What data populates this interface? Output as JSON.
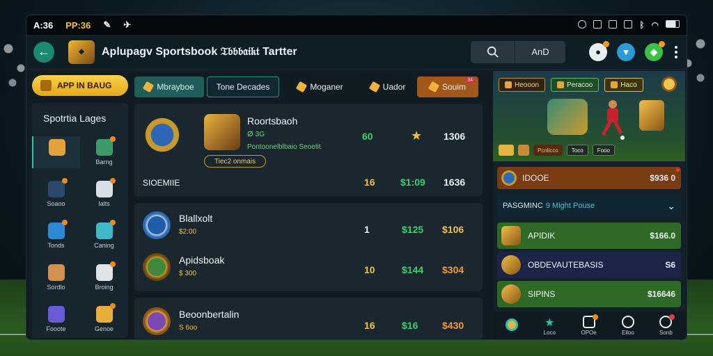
{
  "status": {
    "time": "A:36",
    "account": "PP:36"
  },
  "header": {
    "title": "Aplupagv Sportsbook 𝔗𝔟𝔟𝔟𝔞𝔦𝔨𝔱 Tartter",
    "search_label": "AnD"
  },
  "left": {
    "badge": "APP IN BAUG",
    "sidebar_title": "Spotrtia Lages",
    "items": [
      {
        "label": "",
        "icon": "trophy-icon",
        "color": "#e3a33a"
      },
      {
        "label": "Barng",
        "icon": "shield-icon",
        "color": "#3c9a6b"
      },
      {
        "label": "Soaoo",
        "icon": "grid-icon",
        "color": "#2c4a6c"
      },
      {
        "label": "Ialts",
        "icon": "bracket-icon",
        "color": "#d8dfe5"
      },
      {
        "label": "Tonds",
        "icon": "globe-icon",
        "color": "#2d8bd5"
      },
      {
        "label": "Caning",
        "icon": "tablet-icon",
        "color": "#3fb8c7"
      },
      {
        "label": "Sordlo",
        "icon": "cookie-icon",
        "color": "#d3914f"
      },
      {
        "label": "Broing",
        "icon": "dice-icon",
        "color": "#dfe4e8"
      },
      {
        "label": "Fooote",
        "icon": "cube-icon",
        "color": "#6a5bd6"
      },
      {
        "label": "Genoe",
        "icon": "gift-icon",
        "color": "#e8ad3b"
      }
    ]
  },
  "tabs": [
    {
      "label": "Mbrayboe"
    },
    {
      "label": "Tone Decades"
    },
    {
      "label": "Moganer"
    },
    {
      "label": "Uador"
    },
    {
      "label": "Souim",
      "badge": "34"
    }
  ],
  "featured": {
    "name": "Roortsbaoh",
    "sub1": "ⵁ 3G",
    "sub2": "Pontoonelblbaio Seoetit",
    "pill": "Tiec2 onmais",
    "tag": "SIOEMIIE",
    "odds": "60",
    "score": "1306",
    "bottom": [
      "16",
      "$1:09",
      "1636"
    ]
  },
  "rows": [
    {
      "name": "Blallxolt",
      "sub": "$2:00",
      "a": "1",
      "b": "$125",
      "c": "$106"
    },
    {
      "name": "Apidsboak",
      "sub": "$ 300",
      "a": "10",
      "b": "$144",
      "c": "$304"
    },
    {
      "name": "Beoonbertalin",
      "sub": "S 6oo",
      "a": "16",
      "b": "$16",
      "c": "$430"
    }
  ],
  "right": {
    "hero_tabs": [
      "Heooon",
      "Peracoo",
      "Haco"
    ],
    "hero_strip": [
      "Pcnlicco",
      "Toco",
      "Fooo"
    ],
    "promo": {
      "label": "IDOOE",
      "value": "$936 0"
    },
    "dropdown": {
      "label": "PASGMINC",
      "accent": "9 Might Pouse"
    },
    "list": [
      {
        "name": "APIDIK",
        "value": "$166.0",
        "style": "g"
      },
      {
        "name": "OBDEVAUTEBASIS",
        "value": "S6",
        "style": "d"
      },
      {
        "name": "SIPINS",
        "value": "$16646",
        "style": "g"
      }
    ],
    "nav": [
      "",
      "Loco",
      "OPOe",
      "Eiloo",
      "Sonb"
    ]
  },
  "colors": {
    "accent": "#2cc3b0",
    "gold": "#f2c04a",
    "green": "#3fd06a"
  }
}
